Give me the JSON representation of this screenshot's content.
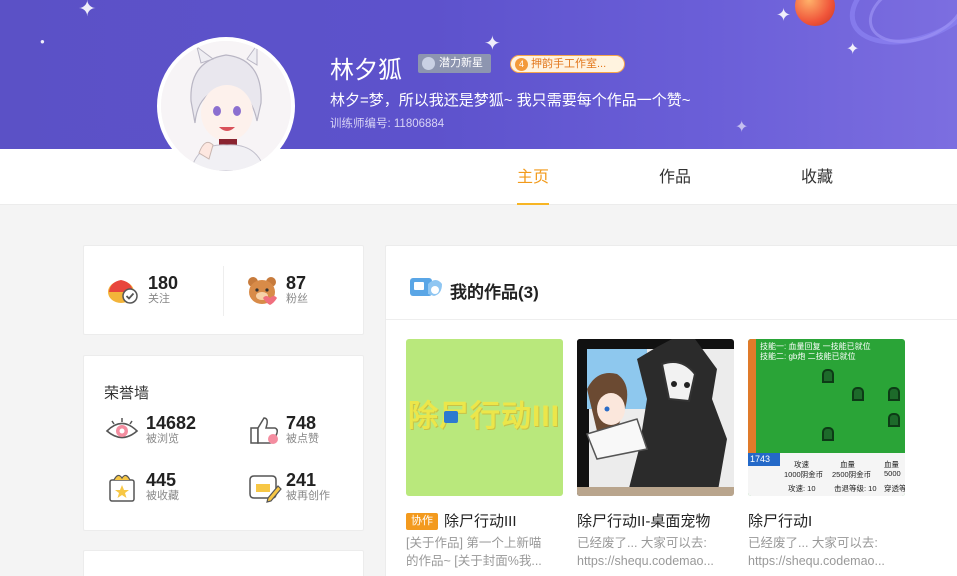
{
  "profile": {
    "name": "林夕狐",
    "badge_level": "潜力新星",
    "badge_studio_num": "4",
    "badge_studio": "押韵手工作室...",
    "motto": "林夕=梦，所以我还是梦狐~ 我只需要每个作品一个赞~",
    "trainer_id": "训练师编号: 11806884"
  },
  "tabs": [
    {
      "label": "主页",
      "active": true
    },
    {
      "label": "作品",
      "active": false
    },
    {
      "label": "收藏",
      "active": false
    }
  ],
  "follow_stats": {
    "following_num": "180",
    "following_label": "关注",
    "fans_num": "87",
    "fans_label": "粉丝"
  },
  "honor": {
    "title": "荣誉墙",
    "views_num": "14682",
    "views_label": "被浏览",
    "likes_num": "748",
    "likes_label": "被点赞",
    "collects_num": "445",
    "collects_label": "被收藏",
    "remix_num": "241",
    "remix_label": "被再创作"
  },
  "works": {
    "title": "我的作品(3)",
    "items": [
      {
        "tag": "协作",
        "title": "除尸行动III",
        "desc1": "[关于作品] 第一个上新喵",
        "desc2": "的作品~ [关于封面%我...",
        "thumb_text": "除尸行动III"
      },
      {
        "title": "除尸行动II-桌面宠物",
        "desc1": "已经废了... 大家可以去:",
        "desc2": "https://shequ.codemao..."
      },
      {
        "title": "除尸行动I",
        "desc1": "已经废了... 大家可以去:",
        "desc2": "https://shequ.codemao..."
      }
    ]
  },
  "game_hud": {
    "skill1": "技能一: 血量回复  一技能已就位",
    "skill2": "技能二: gb炮  二技能已就位",
    "score": "1743",
    "l1": "攻速",
    "l2": "血量",
    "l3": "血量",
    "c1": "1000阴金币",
    "c2": "2500阴金币",
    "c3": "5000",
    "b1": "攻速: 10",
    "b2": "击退等级: 10",
    "b3": "穿透等"
  },
  "colors": {
    "accent": "#f29a1a",
    "banner": "#5b51c6"
  }
}
